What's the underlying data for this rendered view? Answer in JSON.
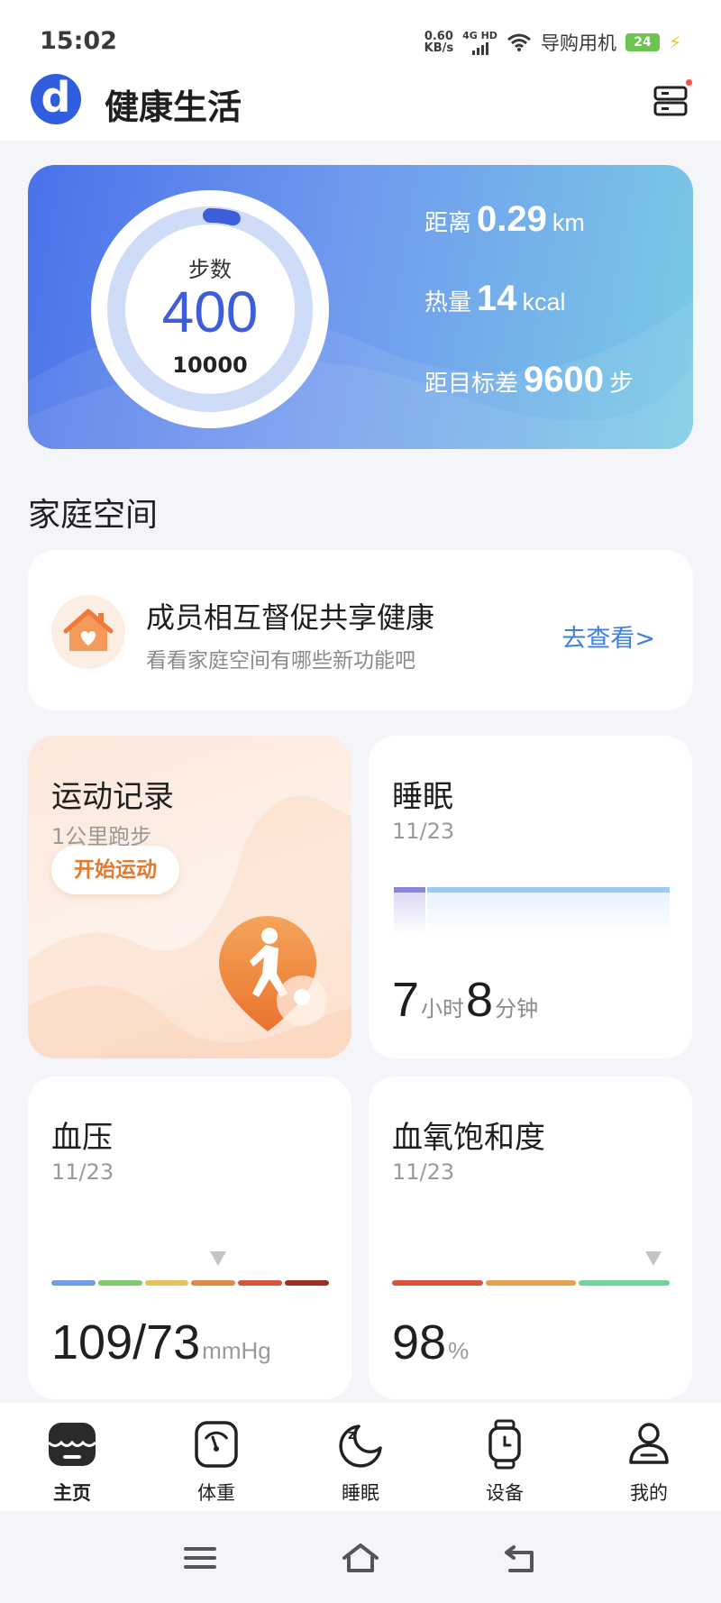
{
  "status_bar": {
    "time": "15:02",
    "net_speed_value": "0.60",
    "net_speed_unit": "KB/s",
    "network_type": "4G HD",
    "carrier": "导购用机",
    "battery_level": "24"
  },
  "header": {
    "logo_letter": "d",
    "title": "健康生活"
  },
  "steps_card": {
    "label": "步数",
    "steps": "400",
    "goal": "10000",
    "progress_fraction": 0.04,
    "distance_label": "距离",
    "distance_value": "0.29",
    "distance_unit": "km",
    "calories_label": "热量",
    "calories_value": "14",
    "calories_unit": "kcal",
    "remaining_label": "距目标差",
    "remaining_value": "9600",
    "remaining_unit": "步"
  },
  "family": {
    "section_title": "家庭空间",
    "title": "成员相互督促共享健康",
    "subtitle": "看看家庭空间有哪些新功能吧",
    "link": "去查看>"
  },
  "exercise": {
    "title": "运动记录",
    "subtitle": "1公里跑步",
    "button": "开始运动"
  },
  "sleep": {
    "title": "睡眠",
    "date": "11/23",
    "hours": "7",
    "hours_unit": "小时",
    "minutes": "8",
    "minutes_unit": "分钟"
  },
  "blood_pressure": {
    "title": "血压",
    "date": "11/23",
    "value": "109/73",
    "unit": "mmHg",
    "marker_fraction": 0.6,
    "scale_colors": [
      "#6f9be8",
      "#7ec96a",
      "#e5c35a",
      "#e08a4a",
      "#d5553d",
      "#9c2e22"
    ]
  },
  "spo2": {
    "title": "血氧饱和度",
    "date": "11/23",
    "value": "98",
    "unit": "%",
    "marker_fraction": 0.94,
    "scale_colors": [
      "#d8553a",
      "#e8a04e",
      "#6fd49a"
    ]
  },
  "bottom_nav": {
    "items": [
      {
        "label": "主页",
        "icon": "home-icon"
      },
      {
        "label": "体重",
        "icon": "scale-icon"
      },
      {
        "label": "睡眠",
        "icon": "moon-icon"
      },
      {
        "label": "设备",
        "icon": "watch-icon"
      },
      {
        "label": "我的",
        "icon": "profile-icon"
      }
    ],
    "active_index": 0
  },
  "colors": {
    "accent": "#3d5ed8",
    "link": "#3d7fe0",
    "exercise_accent": "#e07a30"
  }
}
